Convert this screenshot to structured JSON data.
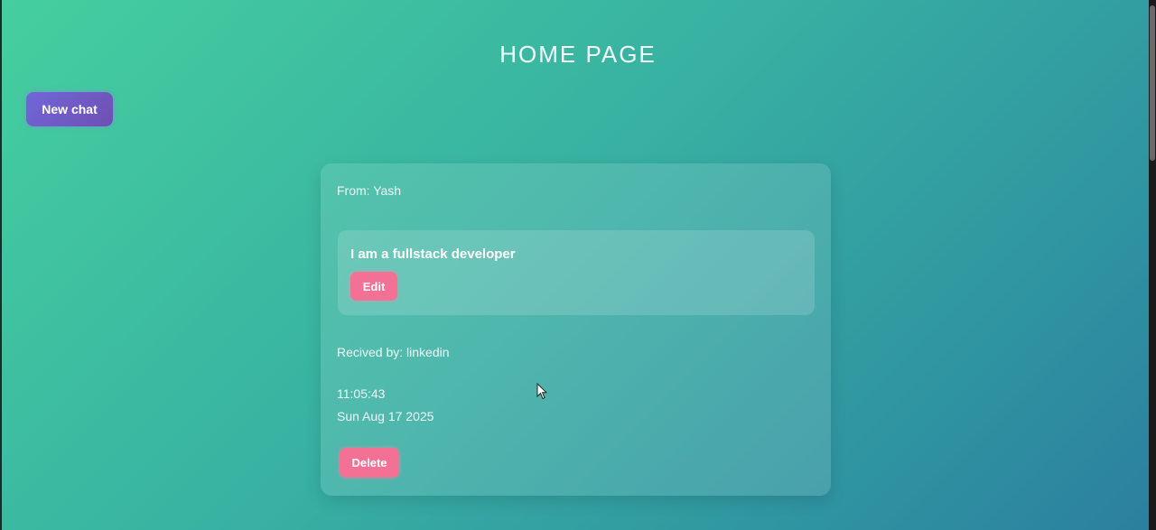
{
  "page": {
    "title": "HOME PAGE"
  },
  "toolbar": {
    "new_chat_label": "New chat"
  },
  "message": {
    "from_label": "From:",
    "from_name": "Yash",
    "from_text": "From: Yash",
    "content": "I am a fullstack developer",
    "edit_label": "Edit",
    "received_text": "Recived by: linkedin",
    "time": "11:05:43",
    "date": "Sun Aug 17 2025",
    "delete_label": "Delete"
  },
  "colors": {
    "background_start": "#45cf9f",
    "background_end": "#2b7f9f",
    "primary_button": "#6f5fd0",
    "danger_button": "#f27195"
  },
  "icons": {
    "cursor": "mouse-pointer-icon"
  }
}
